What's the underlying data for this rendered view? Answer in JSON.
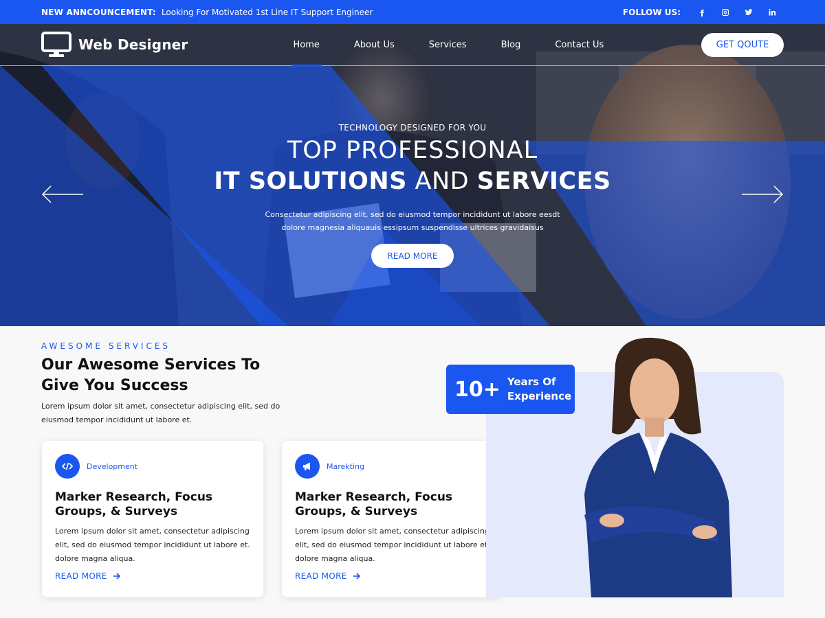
{
  "topbar": {
    "announcement_label": "NEW ANNCOUNCEMENT:",
    "announcement_text": "Looking For Motivated 1st Line IT Support Engineer",
    "follow_label": "FOLLOW US:",
    "social_icons": [
      "facebook-icon",
      "instagram-icon",
      "twitter-icon",
      "linkedin-icon"
    ]
  },
  "header": {
    "logo_text": "Web Designer",
    "nav": [
      {
        "label": "Home",
        "active": true
      },
      {
        "label": "About Us"
      },
      {
        "label": "Services"
      },
      {
        "label": "Blog"
      },
      {
        "label": "Contact Us"
      }
    ],
    "quote_button": "GET QOUTE"
  },
  "hero": {
    "eyebrow": "TECHNOLOGY DESIGNED FOR YOU",
    "title_line1": "TOP PROFESSIONAL",
    "title_line2_a": "IT SOLUTIONS",
    "title_line2_b": " AND ",
    "title_line2_c": "SERVICES",
    "description_line1": "Consectetur adipiscing elit, sed do eiusmod tempor incididunt ut labore eesdt",
    "description_line2": "dolore magnesia aliquauis essipsum suspendisse ultrices gravidaisus",
    "button": "READ MORE"
  },
  "services": {
    "eyebrow": "AWESOME SERVICES",
    "title": "Our Awesome Services To Give You Success",
    "description": "Lorem ipsum dolor sit amet, consectetur adipiscing elit, sed do eiusmod tempor incididunt ut labore et.",
    "cards": [
      {
        "category": "Development",
        "icon": "code-icon",
        "title": "Marker Research, Focus Groups, & Surveys",
        "text": "Lorem ipsum dolor sit amet, consectetur adipiscing elit, sed do eiusmod tempor incididunt ut labore et. dolore magna aliqua.",
        "link": "READ MORE"
      },
      {
        "category": "Marekting",
        "icon": "megaphone-icon",
        "title": "Marker Research, Focus Groups, & Surveys",
        "text": "Lorem ipsum dolor sit amet, consectetur adipiscing elit, sed do eiusmod tempor incididunt ut labore et. dolore magna aliqua.",
        "link": "READ MORE"
      }
    ],
    "experience_number": "10+",
    "experience_line1": "Years Of",
    "experience_line2": "Experience"
  },
  "colors": {
    "brand_blue": "#1a56f0",
    "panel_light": "#e4eafb"
  }
}
